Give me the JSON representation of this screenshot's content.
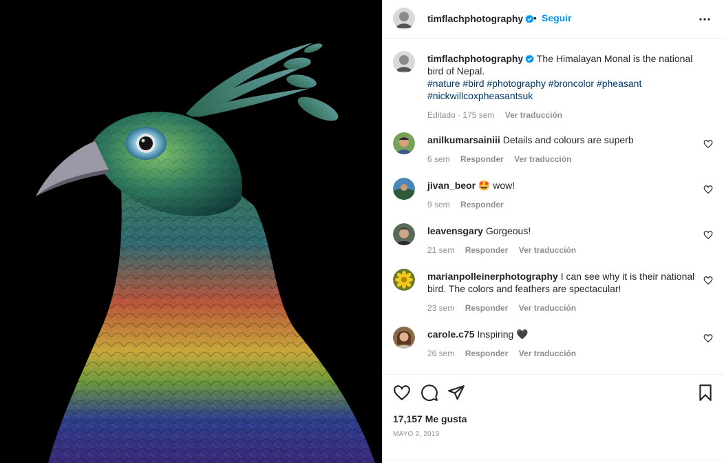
{
  "post": {
    "username": "timflachphotography",
    "separator": "•",
    "follow_label": "Seguir",
    "more_icon": "more-horizontal-icon",
    "verified_color": "#0095f6"
  },
  "caption": {
    "username": "timflachphotography",
    "text": "The Himalayan Monal is the national bird of Nepal.",
    "hashtags": "#nature #bird #photography #broncolor #pheasant #nickwillcoxpheasantsuk",
    "edited": "Editado",
    "dot": "·",
    "age": "175 sem",
    "translate": "Ver traducción"
  },
  "comments": [
    {
      "username": "anilkumarsainiii",
      "text": "Details and colours are superb",
      "age": "6 sem",
      "reply": "Responder",
      "translate": "Ver traducción"
    },
    {
      "username": "jivan_beor",
      "text": "🤩 wow!",
      "age": "9 sem",
      "reply": "Responder",
      "translate": ""
    },
    {
      "username": "leavensgary",
      "text": "Gorgeous!",
      "age": "21 sem",
      "reply": "Responder",
      "translate": "Ver traducción"
    },
    {
      "username": "marianpolleinerphotography",
      "text": "I can see why it is their national bird. The colors and feathers are spectacular!",
      "age": "23 sem",
      "reply": "Responder",
      "translate": "Ver traducción"
    },
    {
      "username": "carole.c75",
      "text": "Inspiring 🖤",
      "age": "26 sem",
      "reply": "Responder",
      "translate": "Ver traducción"
    }
  ],
  "actions": {
    "likes": "17,157 Me gusta",
    "date": "MAYO 2, 2019",
    "icons": [
      "heart-icon",
      "comment-icon",
      "share-icon",
      "bookmark-icon"
    ]
  },
  "colors": {
    "link": "#0095f6",
    "hashtag": "#00376b",
    "muted": "#8e8e8e",
    "text": "#262626"
  }
}
